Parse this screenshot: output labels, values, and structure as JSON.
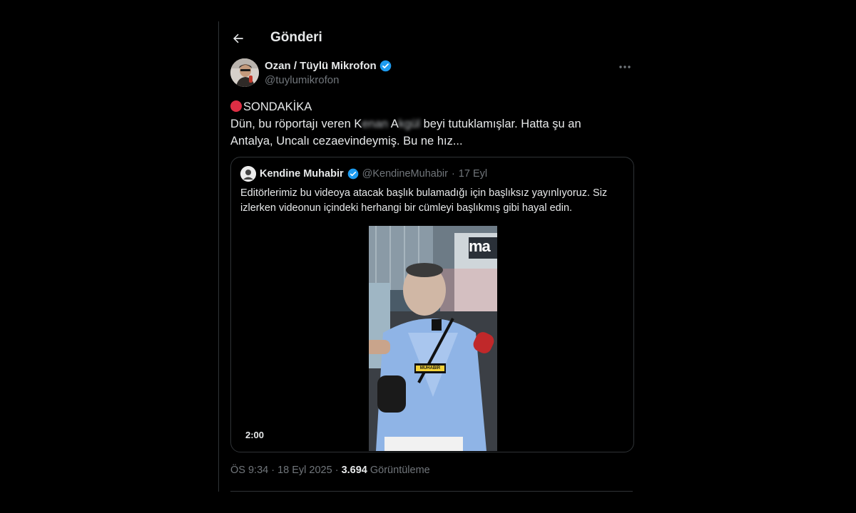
{
  "header": {
    "title": "Gönderi",
    "back_icon": "arrow-left-icon"
  },
  "tweet": {
    "author_name": "Ozan / Tüylü Mikrofon",
    "author_handle": "@tuylumikrofon",
    "verified": true,
    "text_line1": "SONDAKİKA",
    "text_part1": "Dün, bu röportajı veren K",
    "blur1": "enan",
    "text_part2": " A",
    "blur2": "kgül",
    "text_part3": " beyi tutuklamışlar. Hatta şu an Antalya, Uncalı cezaevindeymiş. Bu ne hız...",
    "timestamp": "ÖS 9:34 · 18 Eyl 2025 · ",
    "views_count": "3.694",
    "views_label": " Görüntüleme"
  },
  "quote": {
    "author_name": "Kendine Muhabir",
    "author_handle": "@KendineMuhabir",
    "separator": "·",
    "date": "17 Eyl",
    "text": "Editörlerimiz bu videoya atacak başlık bulamadığı için başlıksız yayınlıyoruz. Siz izlerken videonun içindeki herhangi bir cümleyi başlıkmış gibi hayal edin.",
    "video_duration": "2:00",
    "video_sign": "ma",
    "video_logo": "MUHABIR"
  },
  "colors": {
    "background": "#000000",
    "text": "#e7e9ea",
    "muted": "#71767b",
    "border": "#2f3336",
    "verified": "#1d9bf0",
    "alert_red": "#dd2e44"
  }
}
